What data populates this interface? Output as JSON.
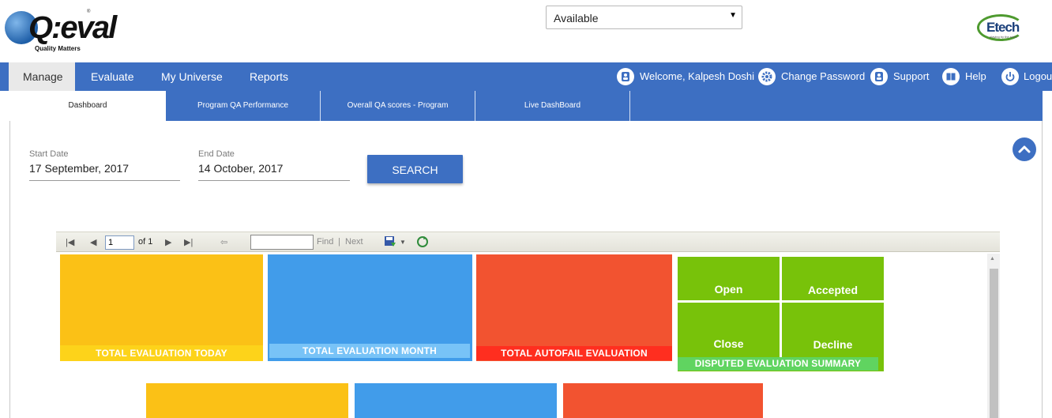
{
  "brand": {
    "logo_word": "Q:eval",
    "logo_tagline": "Quality Matters",
    "logo_registered": "®",
    "partner_logo_word": "Etech",
    "partner_logo_tagline": "playing by the rules"
  },
  "status": {
    "selected": "Available"
  },
  "nav": {
    "items": [
      {
        "label": "Manage"
      },
      {
        "label": "Evaluate"
      },
      {
        "label": "My Universe"
      },
      {
        "label": "Reports"
      }
    ],
    "right": {
      "welcome": "Welcome, Kalpesh Doshi",
      "change_password": "Change Password",
      "support": "Support",
      "help": "Help",
      "logout": "Logout"
    }
  },
  "subtabs": [
    {
      "label": "Dashboard"
    },
    {
      "label": "Program QA Performance"
    },
    {
      "label": "Overall QA scores - Program"
    },
    {
      "label": "Live DashBoard"
    }
  ],
  "filters": {
    "start_label": "Start Date",
    "start_value": "17 September, 2017",
    "end_label": "End Date",
    "end_value": "14 October, 2017",
    "search_label": "SEARCH"
  },
  "toolbar": {
    "page": "1",
    "of": "of 1",
    "find": "Find",
    "sep": "|",
    "next": "Next"
  },
  "tiles": {
    "today": "TOTAL EVALUATION  TODAY",
    "month": "TOTAL EVALUATION MONTH",
    "autofail": "TOTAL AUTOFAIL EVALUATION",
    "disputed": "DISPUTED EVALUATION SUMMARY",
    "open": "Open",
    "accepted": "Accepted",
    "close": "Close",
    "decline": "Decline"
  },
  "colors": {
    "nav_blue": "#3d6fc2",
    "tile_yellow": "#fbc116",
    "tile_blue": "#419cea",
    "tile_red": "#f25330",
    "tile_green": "#78c20a"
  }
}
